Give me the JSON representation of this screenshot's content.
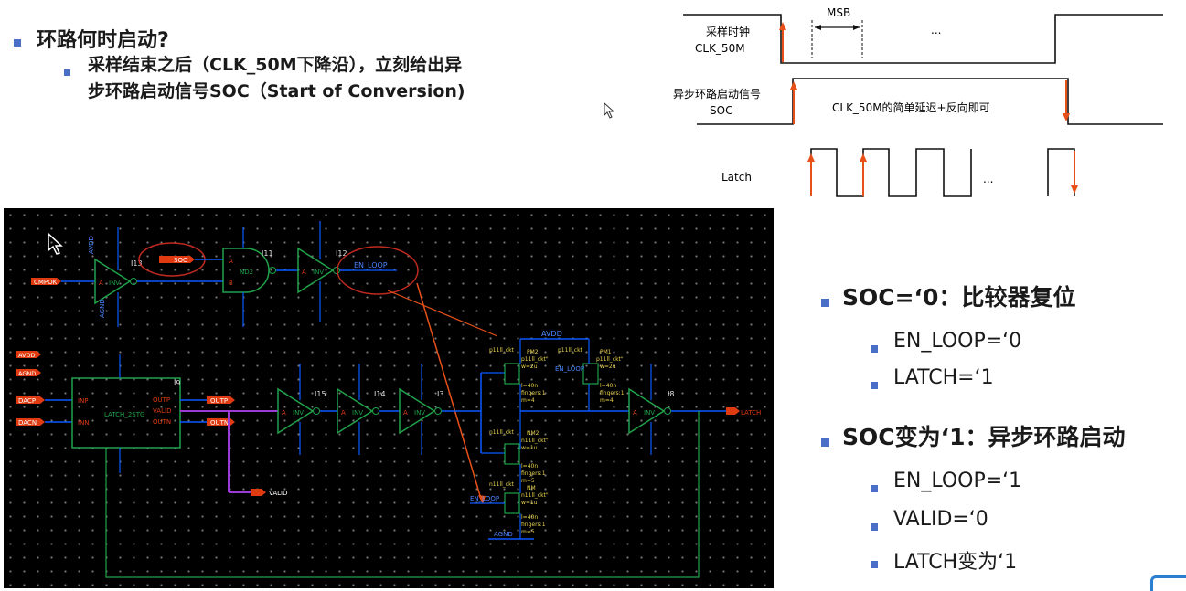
{
  "left_bullets": {
    "main": "环路何时启动?",
    "sub_line1": "采样结束之后（CLK_50M下降沿），立刻给出异",
    "sub_line2": "步环路启动信号SOC（Start of Conversion)"
  },
  "timing": {
    "clk_label_cn": "采样时钟",
    "clk_label": "CLK_50M",
    "soc_label_cn": "异步环路启动信号",
    "soc_label": "SOC",
    "latch_label": "Latch",
    "msb_label": "MSB",
    "dots": "...",
    "note": "CLK_50M的简单延迟+反向即可"
  },
  "right_bullets": {
    "h1": "SOC=‘0：比较器复位",
    "h1_items": [
      "EN_LOOP=‘0",
      "LATCH=‘1"
    ],
    "h2": "SOC变为‘1：异步环路启动",
    "h2_items": [
      "EN_LOOP=‘1",
      "VALID=‘0",
      "LATCH变为‘1"
    ]
  },
  "schematic": {
    "pins": {
      "cmpok": "CMPOK",
      "soc": "SOC",
      "avdd_in": "AVDD",
      "agnd_in": "AGND",
      "dacp": "DACP",
      "dacn": "DACN",
      "outp": "OUTP",
      "outn": "OUTN",
      "valid": "VALID",
      "latch": "LATCH",
      "en_loop": "EN_LOOP",
      "en_loop2": "EN_LOOP",
      "enloop_mid": "EN_LOOP",
      "avdd_rail": "AVDD",
      "agnd_rail": "AGND"
    },
    "instances": {
      "i13": "I13",
      "i11": "I11",
      "i12": "I12",
      "i15": "I15",
      "i14": "I14",
      "i3": "I3",
      "i8": "I8",
      "i9": "I9",
      "nd2": "ND2",
      "inv": "INV",
      "latch_cell": "LATCH_2STG",
      "pm2": "PM2",
      "pm1": "PM1",
      "nm2": "NM2",
      "nm": "NM"
    },
    "supply": {
      "avdd": "AVDD",
      "agnd": "AGND"
    },
    "ports": {
      "a": "A",
      "b": "B",
      "y": "Y",
      "inp": "INP",
      "inn": "INN",
      "outp_port": "OUTP",
      "valid_port": "VALID",
      "outn_port": "OUTN"
    },
    "params": {
      "p_model": "p11ll_ckt",
      "n_model": "n11ll_ckt",
      "pm2_p": "p11ll_ckt\"",
      "pm2_w": "w=2u",
      "pm2_l": "l=40n",
      "pm2_f": "fingers:1",
      "pm2_m": "m=4",
      "pm1_p": "p11ll_ckt\"",
      "pm1_w": "w=2u",
      "pm1_l": "l=40n",
      "pm1_f": "fingers:1",
      "pm1_m": "m=4",
      "nm2_p": "n11ll_ckt\"",
      "nm2_w": "w=1u",
      "nm2_l": "l=40n",
      "nm2_f": "fingers:1",
      "nm2_m": "m=5",
      "nm_p": "n11ll_ckt\"",
      "nm_w": "w=1u",
      "nm_l": "l=40n",
      "nm_f": "fingers:1",
      "nm_m": "m=5"
    }
  },
  "colors": {
    "accent": "#4a6fc7",
    "wire": "#0a59ff",
    "pin": "#e03a10",
    "signal_arrow": "#e8501a",
    "corner": "#2b7fd1"
  }
}
